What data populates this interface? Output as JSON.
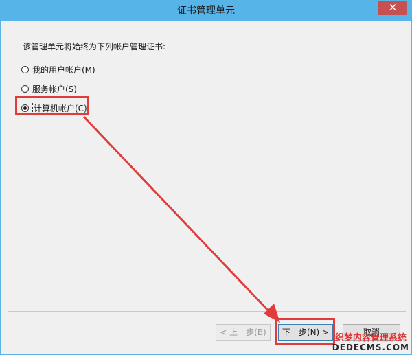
{
  "window": {
    "title": "证书管理单元",
    "close_glyph": "✕"
  },
  "prompt": "该管理单元将始终为下列帐户管理证书:",
  "options": [
    {
      "label": "我的用户帐户(M)",
      "checked": false
    },
    {
      "label": "服务帐户(S)",
      "checked": false
    },
    {
      "label": "计算机帐户(C)",
      "checked": true
    }
  ],
  "buttons": {
    "back": "< 上一步(B)",
    "next": "下一步(N) >",
    "cancel": "取消"
  },
  "annotation": {
    "color": "#e03c3c"
  },
  "watermark": {
    "line1": "织梦内容管理系统",
    "line2": "DEDECMS.COM"
  }
}
